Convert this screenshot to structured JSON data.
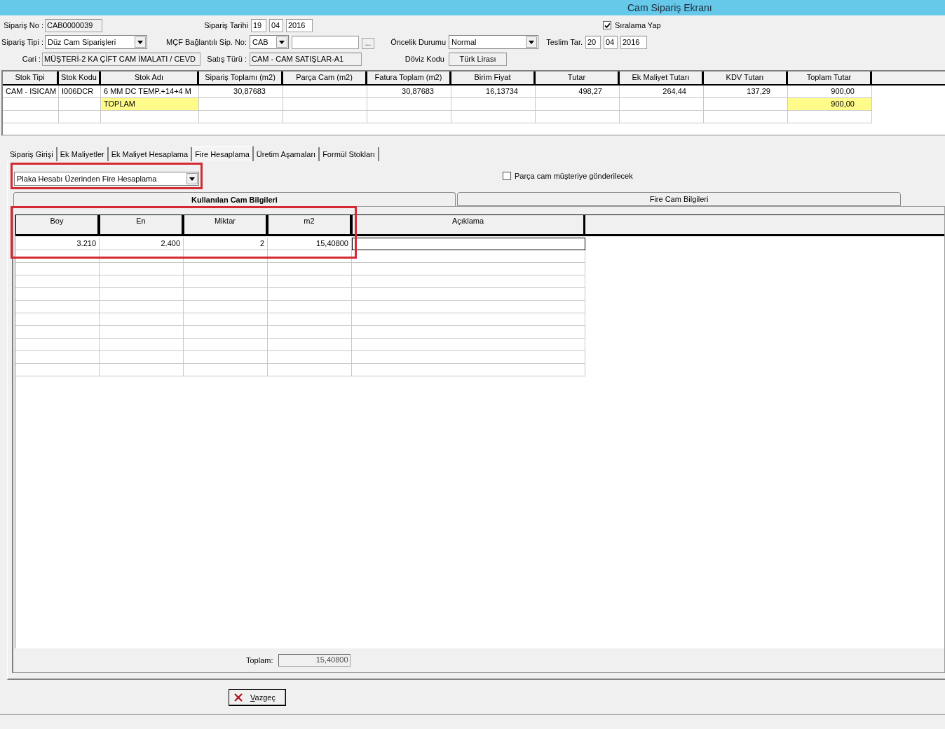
{
  "window": {
    "title": "Cam Sipariş Ekranı"
  },
  "header": {
    "siparis_no": {
      "label": "Sipariş No :",
      "value": "CAB0000039"
    },
    "siparis_tarihi": {
      "label": "Sipariş Tarihi",
      "day": "19",
      "month": "04",
      "year": "2016"
    },
    "siralama": {
      "label": "Sıralama Yap",
      "checked": true
    },
    "siparis_tipi": {
      "label": "Sipariş Tipi :",
      "value": "Düz Cam Siparişleri"
    },
    "mcf": {
      "label": "MÇF Bağlantılı Sip. No:",
      "value": "CAB",
      "button": "..."
    },
    "oncelik": {
      "label": "Öncelik Durumu",
      "value": "Normal"
    },
    "teslim": {
      "label": "Teslim Tar.",
      "day": "20",
      "month": "04",
      "year": "2016"
    },
    "cari": {
      "label": "Cari :",
      "value": "MÜŞTERİ-2 KA ÇİFT CAM İMALATI / CEVD"
    },
    "satis_turu": {
      "label": "Satış Türü :",
      "value": "CAM - CAM SATIŞLAR-A1"
    },
    "doviz": {
      "label": "Döviz Kodu",
      "value": "Türk Lirası"
    }
  },
  "order_table": {
    "columns": [
      "Stok Tipi",
      "Stok Kodu",
      "Stok Adı",
      "Sipariş Toplamı (m2)",
      "Parça Cam (m2)",
      "Fatura Toplam (m2)",
      "Birim Fiyat",
      "Tutar",
      "Ek Maliyet Tutarı",
      "KDV Tutarı",
      "Toplam Tutar"
    ],
    "rows": [
      {
        "kind": "item",
        "cells": [
          "CAM - ISICAM",
          "I006DCR",
          "6 MM DC TEMP.+14+4 M",
          "30,87683",
          null,
          "30,87683",
          "16,13734",
          "498,27",
          "264,44",
          "137,29",
          "900,00"
        ]
      },
      {
        "kind": "total",
        "label": "TOPLAM",
        "amount": "900,00"
      }
    ]
  },
  "tabs": [
    {
      "label": "Sipariş Girişi",
      "selected": false
    },
    {
      "label": "Ek Maliyetler",
      "selected": false
    },
    {
      "label": "Ek Maliyet Hesaplama",
      "selected": false
    },
    {
      "label": "Fire Hesaplama",
      "selected": true
    },
    {
      "label": "Üretim Aşamaları",
      "selected": false
    },
    {
      "label": "Formül Stokları",
      "selected": false
    }
  ],
  "fire": {
    "method": {
      "value": "Plaka Hesabı Üzerinden Fire Hesaplama"
    },
    "parca": {
      "label": "Parça cam müşteriye gönderilecek",
      "checked": false
    },
    "subtabs": [
      {
        "label": "Kullanılan Cam Bilgileri",
        "selected": true
      },
      {
        "label": "Fire Cam Bilgileri",
        "selected": false
      }
    ],
    "columns": [
      "Boy",
      "En",
      "Miktar",
      "m2",
      "Açıklama"
    ],
    "rows": [
      {
        "cells": [
          "3.210",
          "2.400",
          "2",
          "15,40800"
        ]
      }
    ],
    "total": {
      "label": "Toplam:",
      "value": "15,40800"
    }
  },
  "buttons": [
    {
      "label": "Vazgeç",
      "kind": "cancel"
    }
  ]
}
